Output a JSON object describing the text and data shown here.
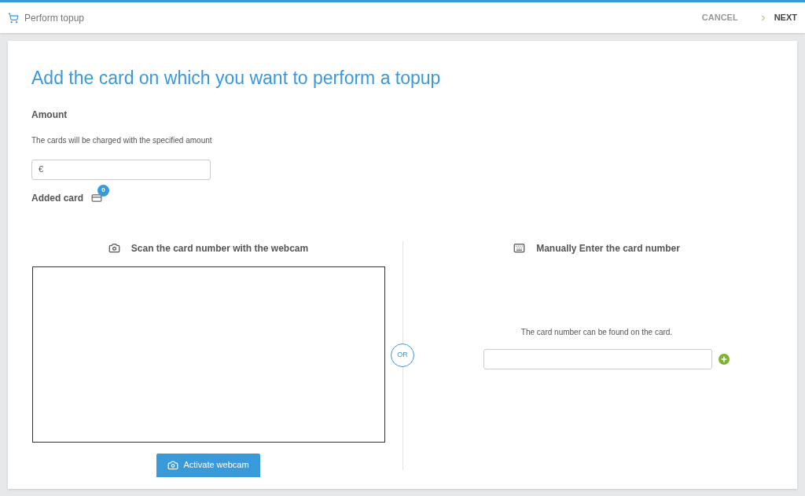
{
  "header": {
    "title": "Perform topup",
    "cancel": "CANCEL",
    "next": "NEXT"
  },
  "page_title": "Add the card on which you want to perform a topup",
  "amount": {
    "label": "Amount",
    "help": "The cards will be charged with the specified amount",
    "currency": "€"
  },
  "added_card": {
    "label": "Added card",
    "count": "0"
  },
  "webcam": {
    "heading": "Scan the card number with the webcam",
    "button": "Activate webcam"
  },
  "separator": "OR",
  "manual": {
    "heading": "Manually Enter the card number",
    "help": "The card number can be found on the card."
  }
}
